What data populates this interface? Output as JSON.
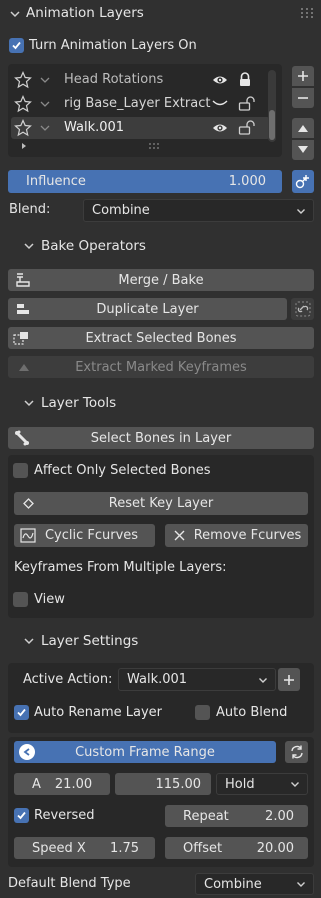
{
  "panel": {
    "title": "Animation Layers",
    "toggle_label": "Turn Animation Layers On"
  },
  "layers": [
    {
      "name": "Head Rotations",
      "visible": true,
      "locked": true
    },
    {
      "name": "rig Base_Layer Extract",
      "visible": false,
      "locked": false
    },
    {
      "name": "Walk.001",
      "visible": true,
      "locked": false,
      "active": true
    }
  ],
  "influence": {
    "label": "Influence",
    "value": "1.000"
  },
  "blend": {
    "label": "Blend:",
    "value": "Combine"
  },
  "bake": {
    "title": "Bake Operators",
    "merge": "Merge / Bake",
    "duplicate": "Duplicate Layer",
    "extract_bones": "Extract Selected Bones",
    "extract_keys": "Extract Marked Keyframes"
  },
  "tools": {
    "title": "Layer Tools",
    "select_bones": "Select Bones in Layer",
    "affect_only": "Affect Only Selected Bones",
    "reset_key": "Reset Key Layer",
    "cyclic": "Cyclic Fcurves",
    "remove": "Remove Fcurves",
    "multi_label": "Keyframes From Multiple Layers:",
    "view": "View"
  },
  "settings": {
    "title": "Layer Settings",
    "active_action_label": "Active Action:",
    "active_action_value": "Walk.001",
    "auto_rename": "Auto Rename Layer",
    "auto_blend": "Auto Blend",
    "custom_range": "Custom Frame Range",
    "range_a_label": "A",
    "range_a": "21.00",
    "range_b": "115.00",
    "extrapolation": "Hold",
    "reversed": "Reversed",
    "repeat_label": "Repeat",
    "repeat": "2.00",
    "speed_label": "Speed X",
    "speed": "1.75",
    "offset_label": "Offset",
    "offset": "20.00"
  },
  "default_blend": {
    "label": "Default Blend Type",
    "value": "Combine"
  },
  "colors": {
    "accent": "#4772b3",
    "background": "#303030",
    "button": "#545454"
  }
}
